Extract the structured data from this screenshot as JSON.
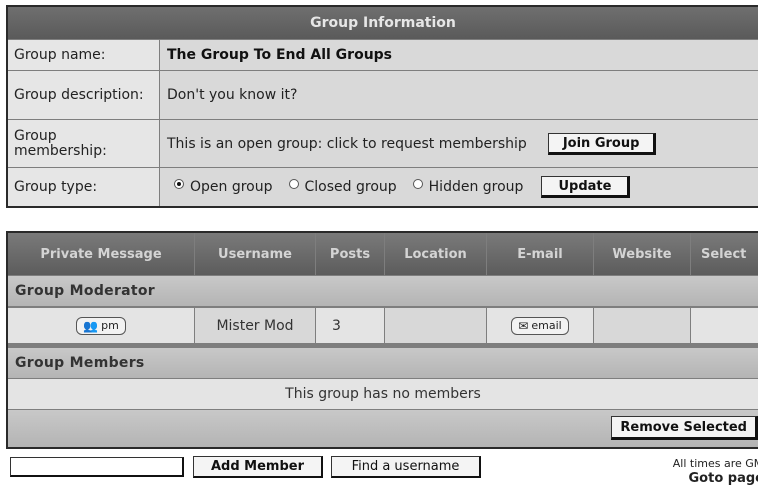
{
  "group_info": {
    "header": "Group Information",
    "rows": [
      {
        "label": "Group name:",
        "value": "The Group To End All Groups"
      },
      {
        "label": "Group description:",
        "value": "Don't you know it?"
      },
      {
        "label": "Group membership:",
        "value": "This is an open group: click to request membership"
      },
      {
        "label": "Group type:"
      }
    ],
    "join_button": "Join Group",
    "group_types": [
      {
        "label": "Open group",
        "selected": true
      },
      {
        "label": "Closed group",
        "selected": false
      },
      {
        "label": "Hidden group",
        "selected": false
      }
    ],
    "update_button": "Update"
  },
  "members_table": {
    "columns": [
      "Private Message",
      "Username",
      "Posts",
      "Location",
      "E-mail",
      "Website",
      "Select"
    ],
    "moderator_section": "Group Moderator",
    "moderator": {
      "pm_label": "pm",
      "username": "Mister Mod",
      "posts": "3",
      "location": "",
      "email_label": "email",
      "website": ""
    },
    "members_section": "Group Members",
    "no_members_text": "This group has no members",
    "remove_button": "Remove Selected"
  },
  "bottom_bar": {
    "add_member_value": "",
    "add_member_button": "Add Member",
    "find_username_button": "Find a username",
    "timezone_text": "All times are GMT",
    "goto_text": "Goto page"
  },
  "icons": {
    "pm": "pm-users-icon",
    "email": "envelope-icon"
  },
  "colors": {
    "header_bg": "#5f5f5f",
    "row_light": "#e6e6e6",
    "row_dark": "#d9d9d9",
    "category_bg": "#bdbdbd",
    "border": "#2a2a2a"
  }
}
